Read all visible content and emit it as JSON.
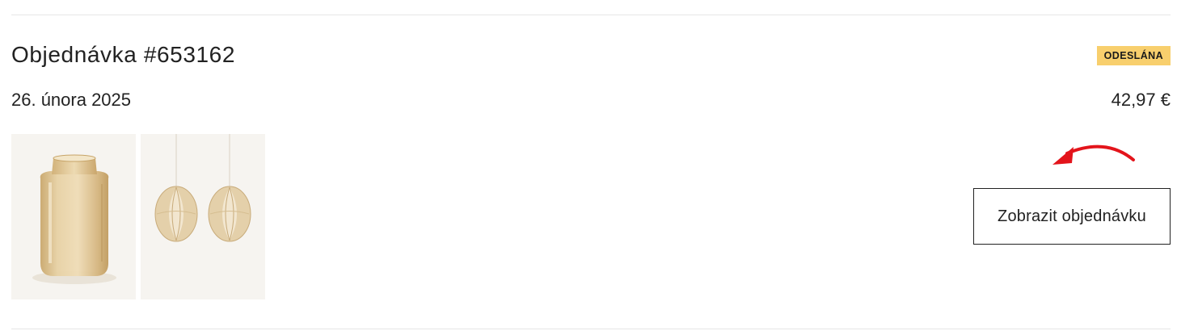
{
  "order": {
    "title": "Objednávka #653162",
    "status": "ODESLÁNA",
    "date": "26. února 2025",
    "total": "42,97 €",
    "view_button_label": "Zobrazit objednávku"
  },
  "products": [
    {
      "kind": "vase-image"
    },
    {
      "kind": "hanging-ornaments-image"
    }
  ],
  "colors": {
    "status_badge": "#f8cf6d",
    "arrow": "#e3141b",
    "text": "#222222",
    "divider": "#e6e6e6",
    "thumbnail_bg": "#f6f4f0"
  },
  "icons": {
    "arrow": "curved-arrow-icon"
  }
}
